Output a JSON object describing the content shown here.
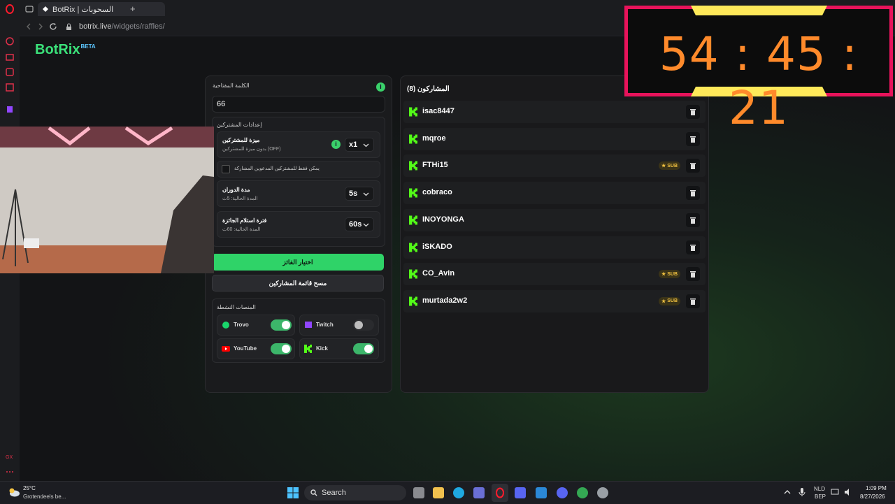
{
  "browser": {
    "tab_title": "BotRix | السحوبات",
    "add_tab": "+",
    "url_domain": "botrix.live",
    "url_path": "/widgets/raffles/"
  },
  "logo": {
    "name": "BotRix",
    "badge": "BETA"
  },
  "config": {
    "keyword_label": "الكلمة المفتاحية",
    "keyword_value": "66",
    "subscriber_settings_label": "إعدادات المشتركين",
    "sub_bonus_title": "ميزة للمشتركين",
    "sub_bonus_desc": "بدون ميزة للمشتركين (OFF)",
    "sub_bonus_value": "x1",
    "only_followers_label": "يمكن فقط للمشتركين المدعوين المشاركة",
    "rotation_title": "مدة الدوران",
    "rotation_desc": "المدة الحالية: 5ث",
    "rotation_value": "5s",
    "claim_title": "فترة استلام الجائزة",
    "claim_desc": "المدة الحالية: 60ث",
    "claim_value": "60s",
    "pick_winner": "اختيار الفائز",
    "clear_list": "مسح قائمة المشاركين",
    "platforms_label": "المنصات النشطة",
    "platforms": [
      {
        "name": "Trovo",
        "enabled": true,
        "color": "#19d66b"
      },
      {
        "name": "Twitch",
        "enabled": false,
        "color": "#9146ff"
      },
      {
        "name": "YouTube",
        "enabled": true,
        "color": "#ff0000"
      },
      {
        "name": "Kick",
        "enabled": true,
        "color": "#53fc18"
      }
    ],
    "info": "i"
  },
  "participants": {
    "title": "المشاركون (8)",
    "sub_label": "SUB",
    "list": [
      {
        "name": "isac8447",
        "sub": false
      },
      {
        "name": "mqroe",
        "sub": false
      },
      {
        "name": "FTHi15",
        "sub": true
      },
      {
        "name": "cobraco",
        "sub": false
      },
      {
        "name": "INOYONGA",
        "sub": false
      },
      {
        "name": "iSKADO",
        "sub": false
      },
      {
        "name": "CO_Avin",
        "sub": true
      },
      {
        "name": "murtada2w2",
        "sub": true
      }
    ]
  },
  "timer": {
    "display": "54 : 45 : 21"
  },
  "taskbar": {
    "weather_temp": "25°C",
    "weather_desc": "Grotendeels be...",
    "search": "Search",
    "lang_top": "NLD",
    "lang_bottom": "BEP",
    "time": "1:09 PM",
    "date": "8/27/2026"
  },
  "colors": {
    "accent": "#3be27a",
    "timer": "#ff8a2b",
    "timer_border": "#e8135b"
  }
}
